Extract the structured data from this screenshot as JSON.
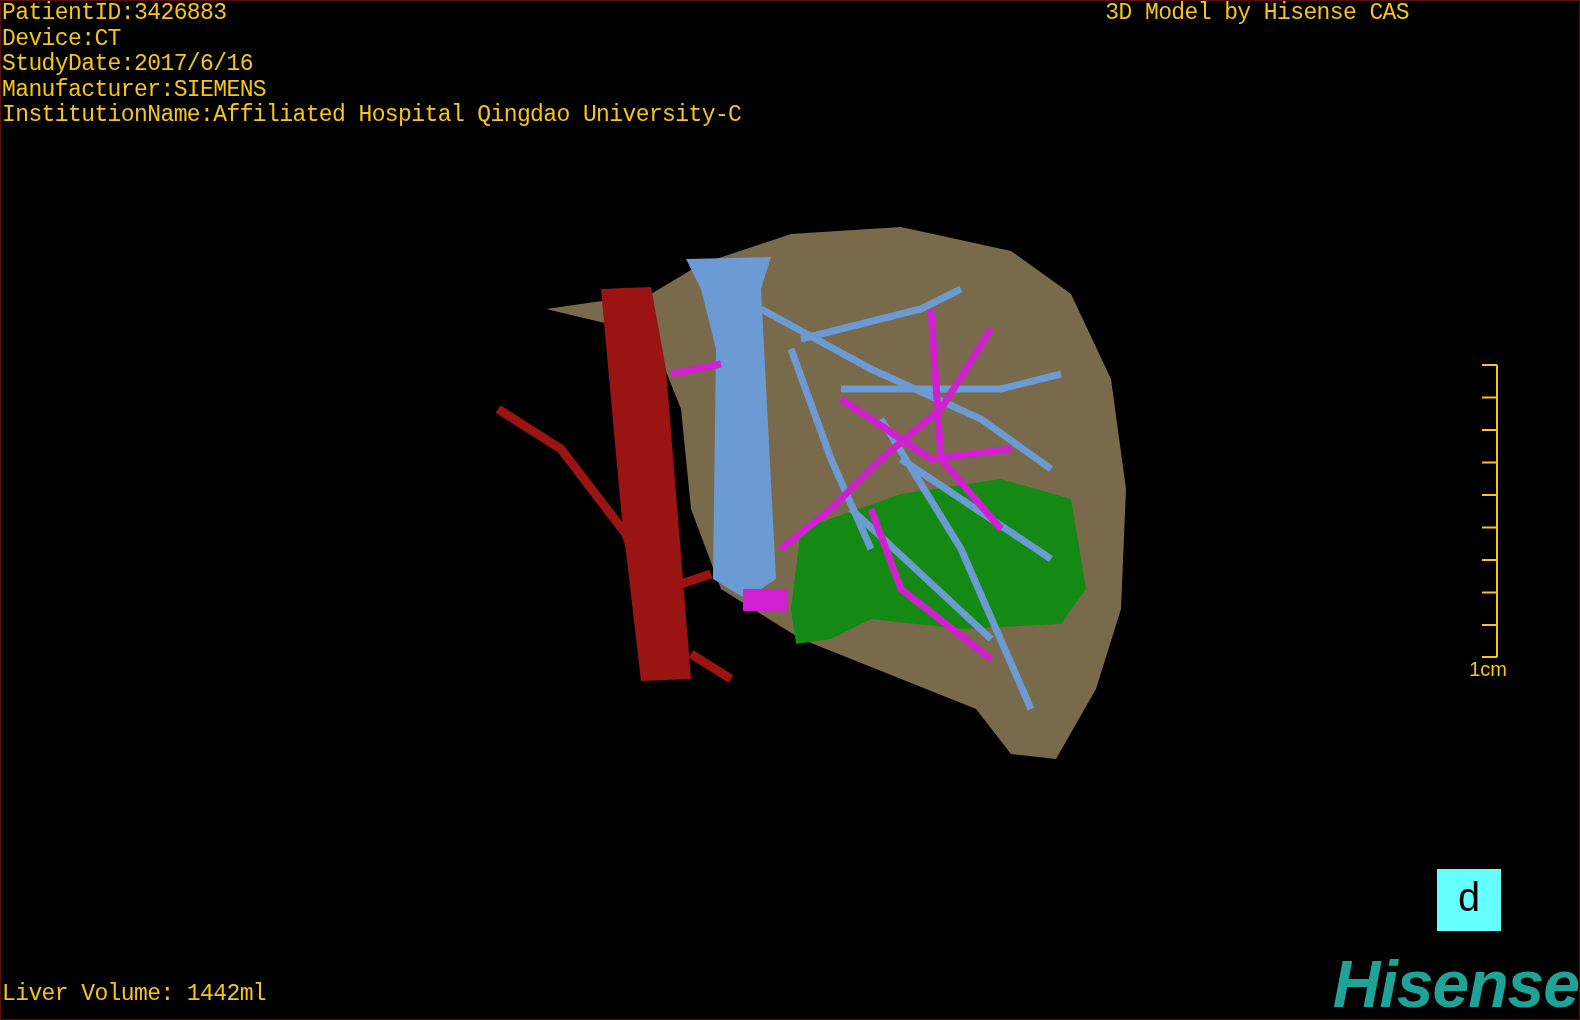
{
  "info_lines": [
    "PatientID:3426883",
    "Device:CT",
    "StudyDate:2017/6/16",
    "Manufacturer:SIEMENS",
    "InstitutionName:Affiliated Hospital Qingdao University-C"
  ],
  "title": "3D Model by Hisense CAS",
  "scale_bar": {
    "label": "1cm"
  },
  "liver_volume": "Liver Volume: 1442ml",
  "panel_label": "d",
  "logo": "Hisense"
}
